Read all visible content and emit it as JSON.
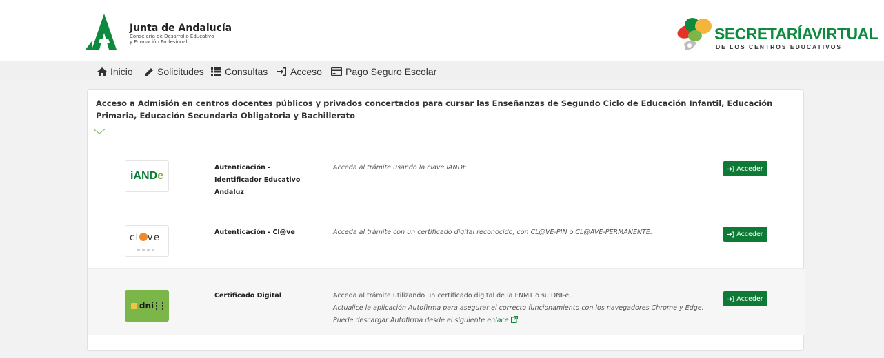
{
  "header": {
    "org_title": "Junta de Andalucía",
    "org_subtitle_line1": "Consejería de Desarrollo Educativo",
    "org_subtitle_line2": "y Formación Profesional",
    "sv_title_part1": "SECRETARÍA",
    "sv_title_part2": "VIRTUAL",
    "sv_subtitle": "DE LOS CENTROS EDUCATIVOS",
    "brand_green": "#0d8a3e"
  },
  "nav": {
    "items": [
      {
        "label": "Inicio",
        "icon": "home-icon"
      },
      {
        "label": "Solicitudes",
        "icon": "pencil-icon"
      },
      {
        "label": "Consultas",
        "icon": "list-icon"
      },
      {
        "label": "Acceso",
        "icon": "sign-in-icon"
      },
      {
        "label": "Pago Seguro Escolar",
        "icon": "credit-card-icon"
      }
    ]
  },
  "panel": {
    "heading": "Acceso a Admisión en centros docentes públicos y privados concertados para cursar las Enseñanzas de Segundo Ciclo de Educación Infantil, Educación Primaria, Educación Secundaria Obligatoria y Bachillerato",
    "methods": [
      {
        "logo": "iANDe",
        "name": "Autenticación - Identificador Educativo Andaluz",
        "description": "Acceda al trámite usando la clave iANDE.",
        "button": "Acceder"
      },
      {
        "logo": "cl@ve",
        "name": "Autenticación - Cl@ve",
        "description": "Acceda al trámite con un certificado digital reconocido, con CL@VE-PIN o CL@AVE-PERMANENTE.",
        "button": "Acceder"
      },
      {
        "logo": "dni",
        "name": "Certificado Digital",
        "description_line1": "Acceda al trámite utilizando un certificado digital de la FNMT o su DNI-e.",
        "description_line2": "Actualice la aplicación Autofirma para asegurar el correcto funcionamiento con los navegadores Chrome y Edge.",
        "description_line3": "Puede descargar Autofirma desde el siguiente",
        "link_text": "enlace",
        "button": "Acceder"
      }
    ]
  }
}
